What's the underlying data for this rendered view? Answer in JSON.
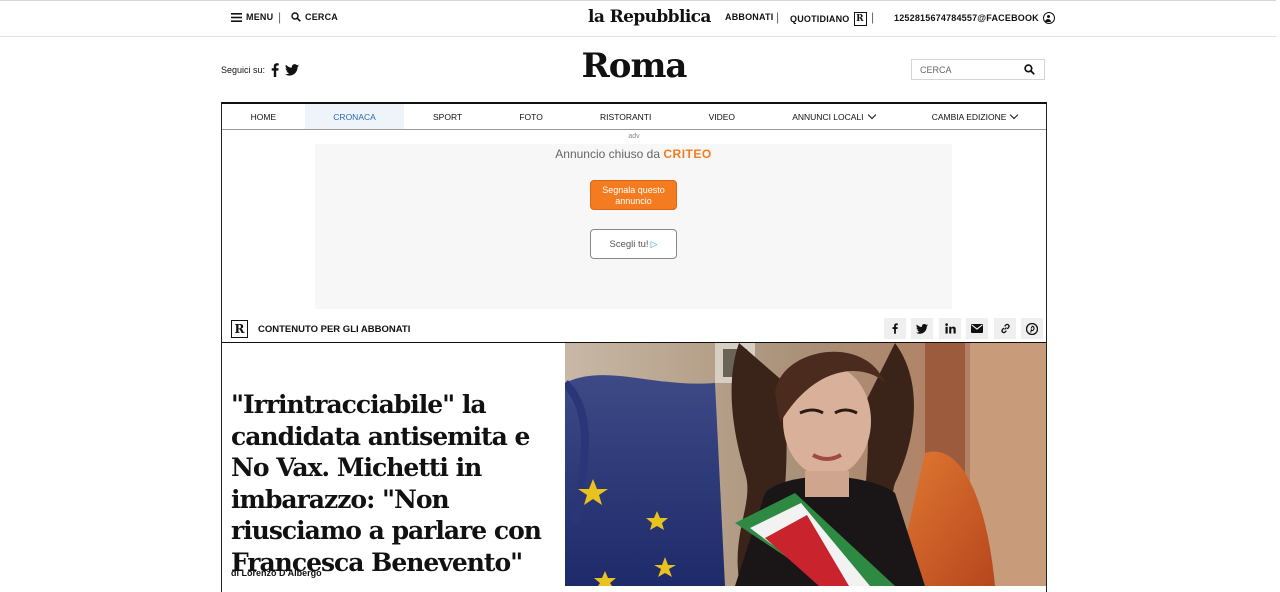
{
  "topbar": {
    "menu_label": "MENU",
    "search_label": "CERCA",
    "logo": "la Repubblica",
    "abbonati": "ABBONATI",
    "quotidiano": "QUOTIDIANO",
    "user": "1252815674784557@FACEBOOK"
  },
  "header": {
    "follow_label": "Seguici su:",
    "edition": "Roma",
    "search_placeholder": "CERCA"
  },
  "nav": {
    "items": [
      {
        "label": "HOME"
      },
      {
        "label": "CRONACA",
        "active": true
      },
      {
        "label": "SPORT"
      },
      {
        "label": "FOTO"
      },
      {
        "label": "RISTORANTI"
      },
      {
        "label": "VIDEO"
      },
      {
        "label": "ANNUNCI LOCALI"
      },
      {
        "label": "CAMBIA EDIZIONE"
      }
    ]
  },
  "ad": {
    "adv_label": "adv",
    "closed_text": "Annuncio chiuso da",
    "closed_brand": "CRITEO",
    "report_button": "Segnala questo annuncio",
    "choose_button": "Scegli tu!"
  },
  "article": {
    "subscriber_label": "CONTENUTO PER GLI ABBONATI",
    "headline": "\"Irrintracciabile\" la candidata antisemita e No Vax. Michetti in imbarazzo: \"Non riusciamo a parlare con Francesca Benevento\"",
    "byline": "di Lorenzo D'Albergo"
  },
  "colors": {
    "accent_active": "#2a6bb0",
    "criteo_orange": "#f47b20"
  }
}
